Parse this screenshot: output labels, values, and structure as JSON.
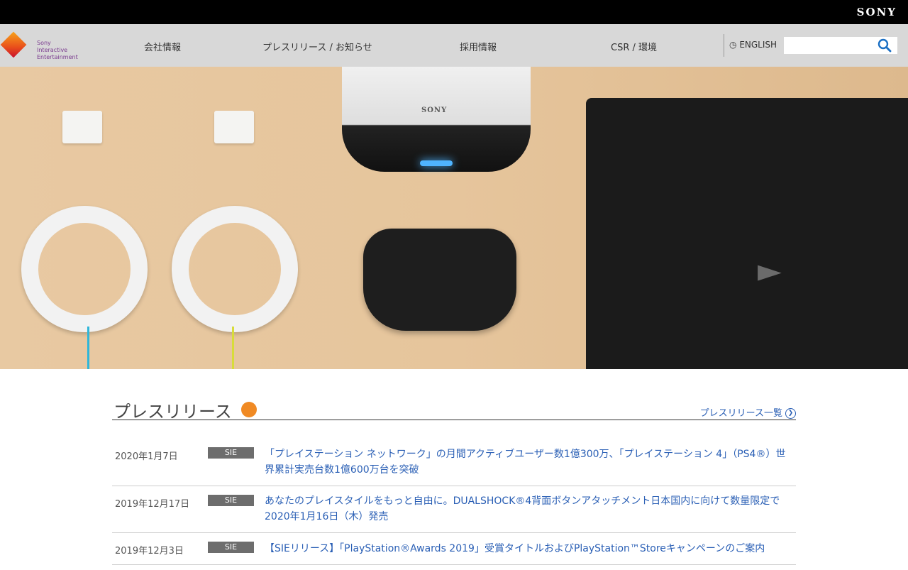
{
  "header": {
    "brand": "SONY"
  },
  "nav": {
    "logo_line1": "Sony",
    "logo_line2": "Interactive",
    "logo_line3": "Entertainment",
    "items": [
      {
        "label": "会社情報"
      },
      {
        "label": "プレスリリース / お知らせ"
      },
      {
        "label": "採用情報"
      },
      {
        "label": "CSR / 環境"
      }
    ],
    "language": "ENGLISH",
    "search_placeholder": ""
  },
  "hero": {
    "headset_brand": "SONY"
  },
  "press": {
    "title": "プレスリリース",
    "more_label": "プレスリリース一覧",
    "items": [
      {
        "date": "2020年1月7日",
        "tag": "SIE",
        "title": "「プレイステーション ネットワーク」の月間アクティブユーザー数1億300万、「プレイステーション 4」（PS4®）世界累計実売台数1億600万台を突破"
      },
      {
        "date": "2019年12月17日",
        "tag": "SIE",
        "title": "あなたのプレイスタイルをもっと自由に。DUALSHOCK®4背面ボタンアタッチメント日本国内に向けて数量限定で2020年1月16日（木）発売"
      },
      {
        "date": "2019年12月3日",
        "tag": "SIE",
        "title": "【SIEリリース】「PlayStation®Awards 2019」受賞タイトルおよびPlayStation™Storeキャンペーンのご案内"
      }
    ]
  },
  "colors": {
    "link": "#2a5fb5",
    "nav_bg": "#d8d8d8",
    "tag_bg": "#6d6d6d",
    "rss": "#f08a24"
  }
}
